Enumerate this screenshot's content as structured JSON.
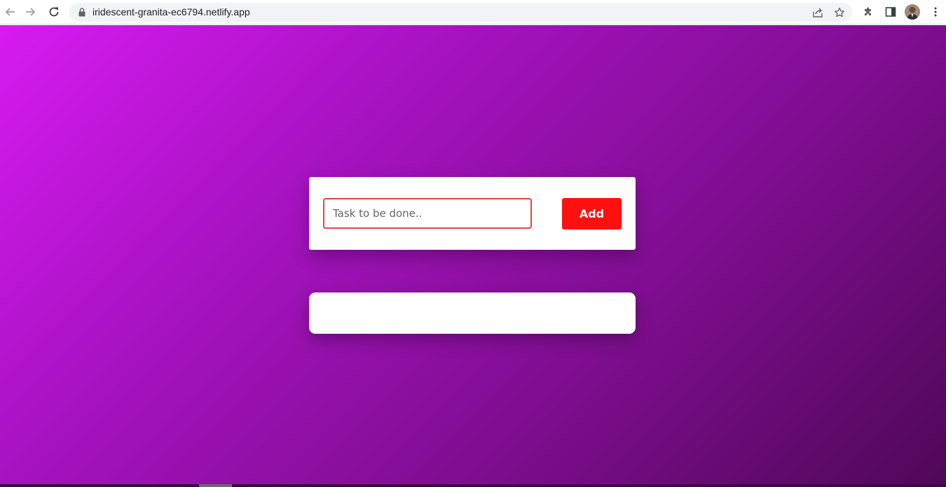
{
  "browser": {
    "url": "iridescent-granita-ec6794.netlify.app",
    "icons": {
      "back": "arrow-left-icon",
      "forward": "arrow-right-icon",
      "reload": "reload-icon",
      "lock": "lock-icon",
      "share": "share-icon",
      "bookmark": "star-icon",
      "extensions": "puzzle-icon",
      "side_panel": "side-panel-icon",
      "menu": "kebab-menu-icon"
    }
  },
  "todo": {
    "input_placeholder": "Task to be done..",
    "input_value": "",
    "add_label": "Add",
    "tasks": []
  },
  "colors": {
    "gradient_start": "#d61bf0",
    "gradient_end": "#4f0858",
    "add_button": "#ff1010",
    "input_border": "#e04848"
  }
}
